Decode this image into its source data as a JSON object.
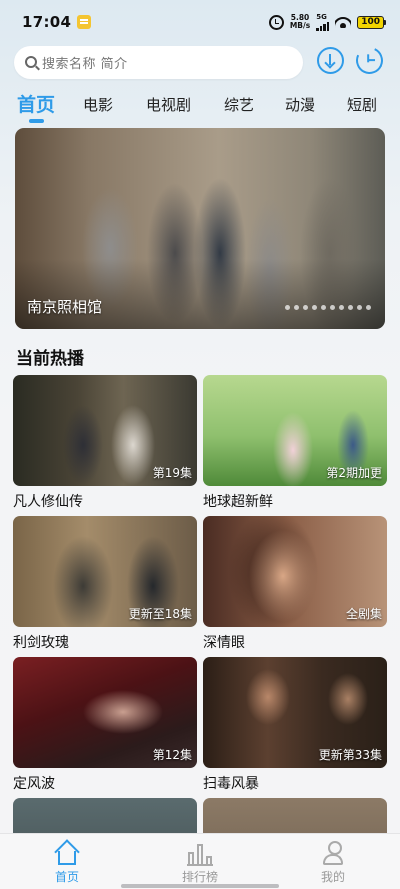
{
  "status_bar": {
    "time": "17:04",
    "net_speed_value": "5.80",
    "net_speed_unit": "MB/s",
    "signal_label": "5G",
    "battery": "100"
  },
  "search": {
    "placeholder": "搜索名称 简介"
  },
  "tabs": [
    "首页",
    "电影",
    "电视剧",
    "综艺",
    "动漫",
    "短剧"
  ],
  "banner": {
    "title": "南京照相馆",
    "dot_count": 10
  },
  "section_title": "当前热播",
  "shows": [
    {
      "title": "凡人修仙传",
      "episode": "第19集"
    },
    {
      "title": "地球超新鲜",
      "episode": "第2期加更"
    },
    {
      "title": "利剑玫瑰",
      "episode": "更新至18集"
    },
    {
      "title": "深情眼",
      "episode": "全剧集"
    },
    {
      "title": "定风波",
      "episode": "第12集"
    },
    {
      "title": "扫毒风暴",
      "episode": "更新第33集"
    }
  ],
  "bottom_nav": [
    {
      "label": "首页",
      "icon": "home-icon"
    },
    {
      "label": "排行榜",
      "icon": "ranking-icon"
    },
    {
      "label": "我的",
      "icon": "profile-icon"
    }
  ],
  "colors": {
    "accent": "#2f9be8"
  }
}
